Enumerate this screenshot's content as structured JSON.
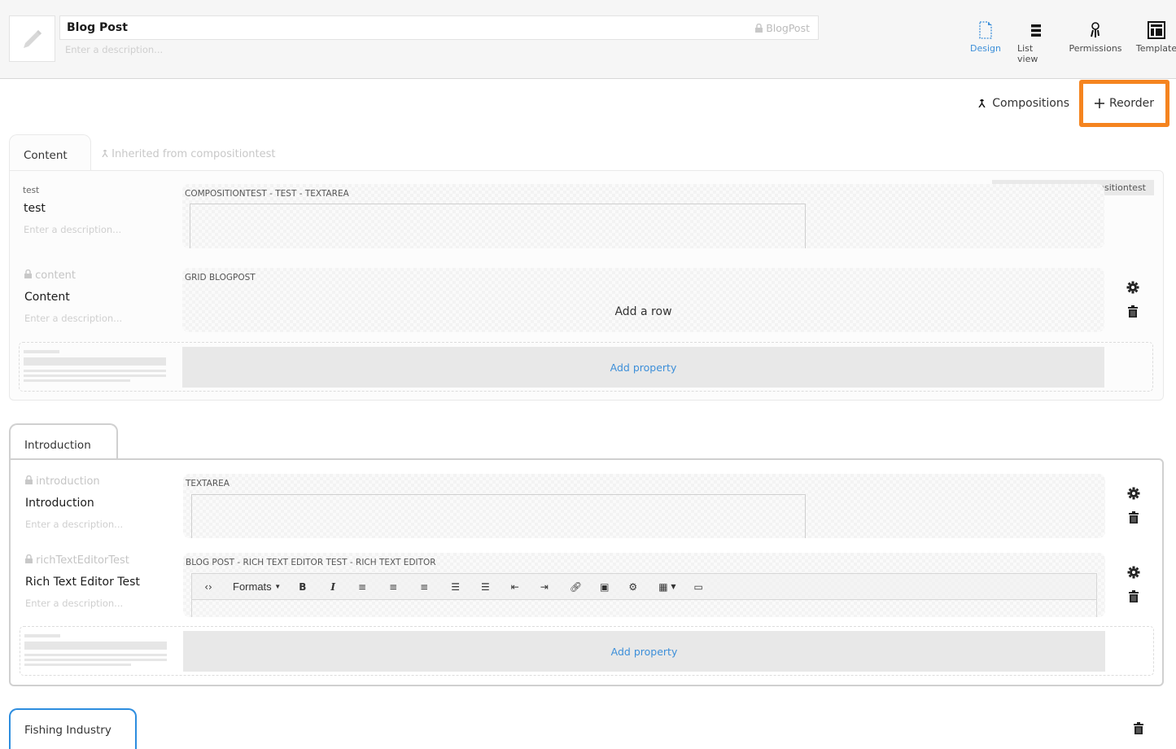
{
  "header": {
    "name": "Blog Post",
    "alias": "BlogPost",
    "description_placeholder": "Enter a description...",
    "nav": [
      {
        "label": "Design",
        "icon": "document-icon",
        "active": true
      },
      {
        "label": "List view",
        "icon": "list-icon",
        "active": false
      },
      {
        "label": "Permissions",
        "icon": "keys-icon",
        "active": false
      },
      {
        "label": "Template",
        "icon": "template-icon",
        "active": false
      }
    ]
  },
  "toolbar": {
    "compositions_label": "Compositions",
    "reorder_label": "Reorder",
    "highlight_color": "#f5841f"
  },
  "groups": [
    {
      "tab": "Content",
      "inherited_label": "Inherited from compositiontest",
      "properties": [
        {
          "alias": "test",
          "name": "test",
          "description_placeholder": "Enter a description...",
          "editor_label": "COMPOSITIONTEST - TEST - TEXTAREA",
          "inherited_badge": "Inherited from compositiontest"
        },
        {
          "alias": "content",
          "name": "Content",
          "description_placeholder": "Enter a description...",
          "editor_label": "GRID BLOGPOST",
          "editor_action": "Add a row"
        }
      ],
      "add_property_label": "Add property"
    },
    {
      "tab": "Introduction",
      "properties": [
        {
          "alias": "introduction",
          "name": "Introduction",
          "description_placeholder": "Enter a description...",
          "editor_label": "TEXTAREA"
        },
        {
          "alias": "richTextEditorTest",
          "name": "Rich Text Editor Test",
          "description_placeholder": "Enter a description...",
          "editor_label": "BLOG POST - RICH TEXT EDITOR TEST - RICH TEXT EDITOR",
          "rte_formats_label": "Formats"
        }
      ],
      "add_property_label": "Add property"
    },
    {
      "tab": "Fishing Industry"
    }
  ],
  "accent_color": "#3d8fd9"
}
